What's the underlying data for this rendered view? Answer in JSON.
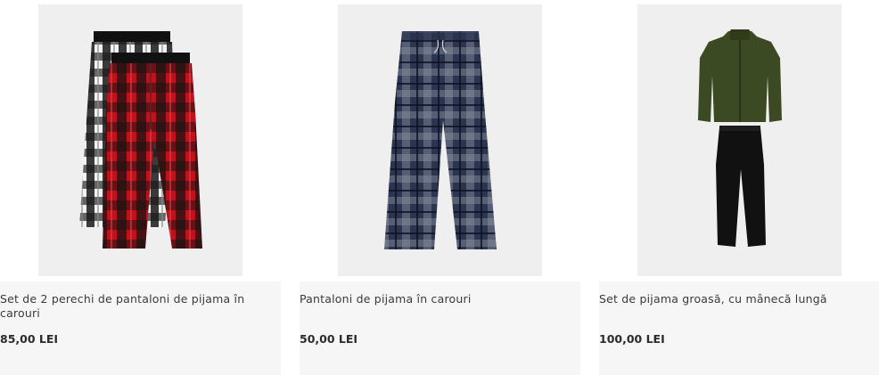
{
  "products": [
    {
      "name": "Set de 2 perechi de pantaloni de pijama în carouri",
      "price": "85,00 LEI"
    },
    {
      "name": "Pantaloni de pijama în carouri",
      "price": "50,00 LEI"
    },
    {
      "name": "Set de pijama groasă, cu mânecă lungă",
      "price": "100,00 LEI"
    }
  ],
  "colors": {
    "image_bg": "#efefef",
    "info_bg": "#f6f6f6",
    "plaid_red": "#b01620",
    "plaid_navy": "#2b3550",
    "fleece_green": "#3b4a22",
    "fleece_black": "#111111"
  }
}
